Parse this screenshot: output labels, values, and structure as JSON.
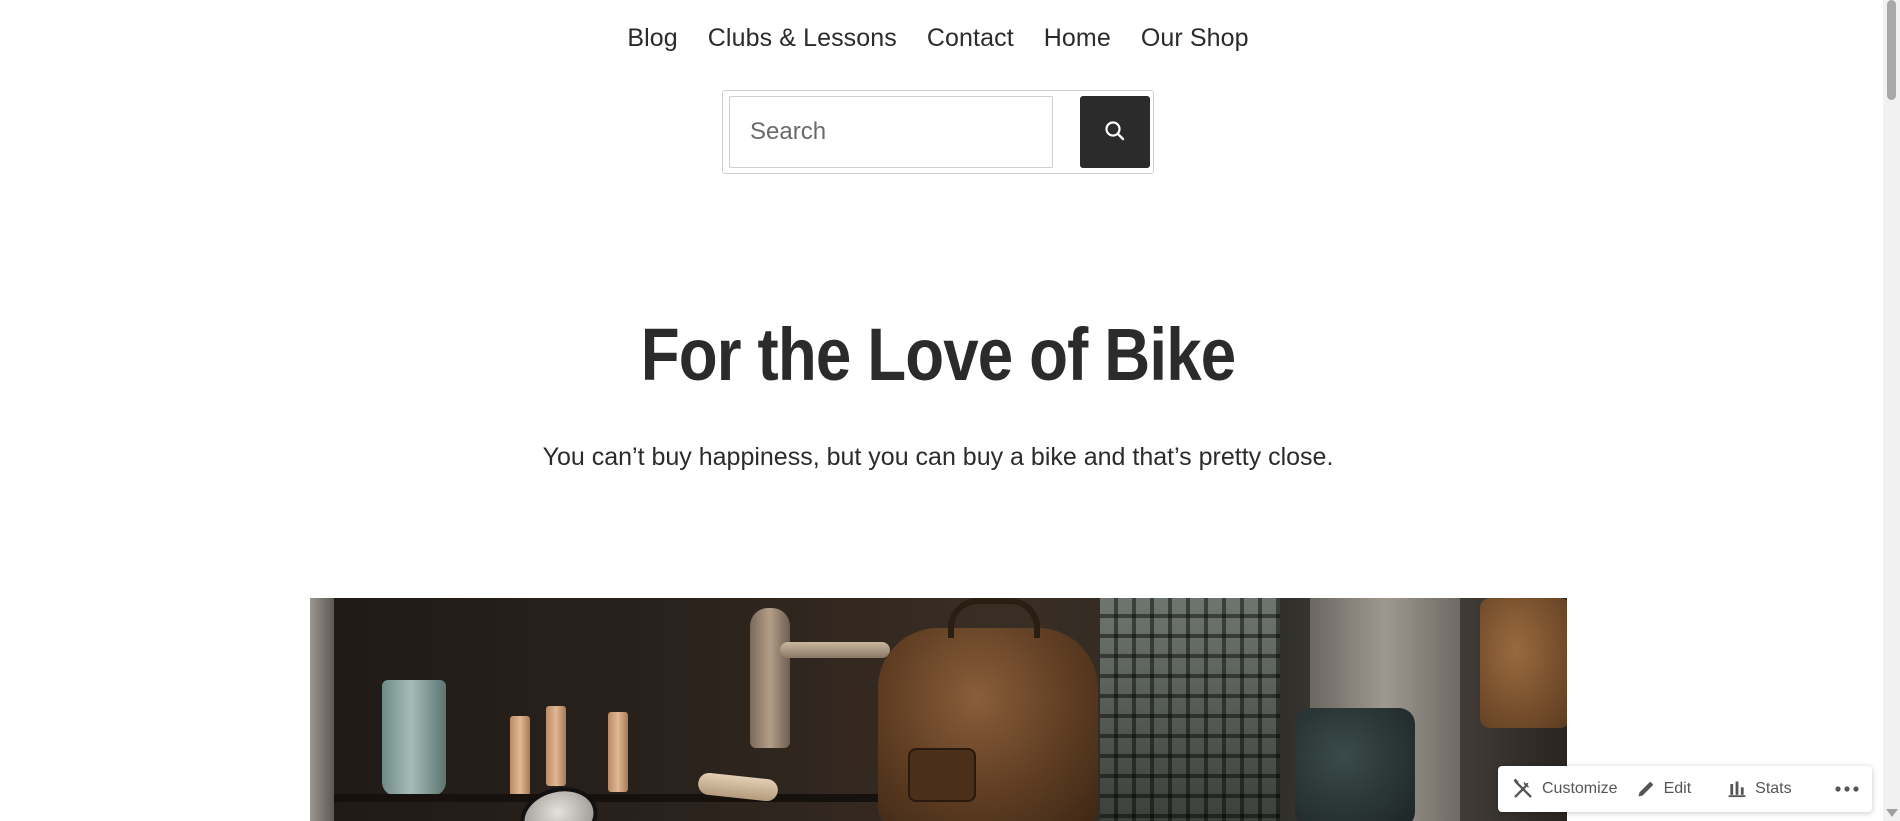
{
  "nav": {
    "items": [
      {
        "label": "Blog"
      },
      {
        "label": "Clubs & Lessons"
      },
      {
        "label": "Contact"
      },
      {
        "label": "Home"
      },
      {
        "label": "Our Shop"
      }
    ]
  },
  "search": {
    "placeholder": "Search",
    "value": "",
    "button_icon": "search-icon"
  },
  "hero": {
    "title": "For the Love of Bike",
    "tagline": "You can’t buy happiness, but you can buy a bike and that’s pretty close."
  },
  "actionbar": {
    "customize_label": "Customize",
    "customize_icon": "tools-icon",
    "edit_label": "Edit",
    "edit_icon": "pencil-icon",
    "stats_label": "Stats",
    "stats_icon": "bar-chart-icon",
    "more_icon": "ellipsis-icon"
  },
  "colors": {
    "text": "#2b2b2b",
    "button_bg": "#2b2b2b",
    "border": "#cfcfcf",
    "actionbar_text": "#555555"
  }
}
